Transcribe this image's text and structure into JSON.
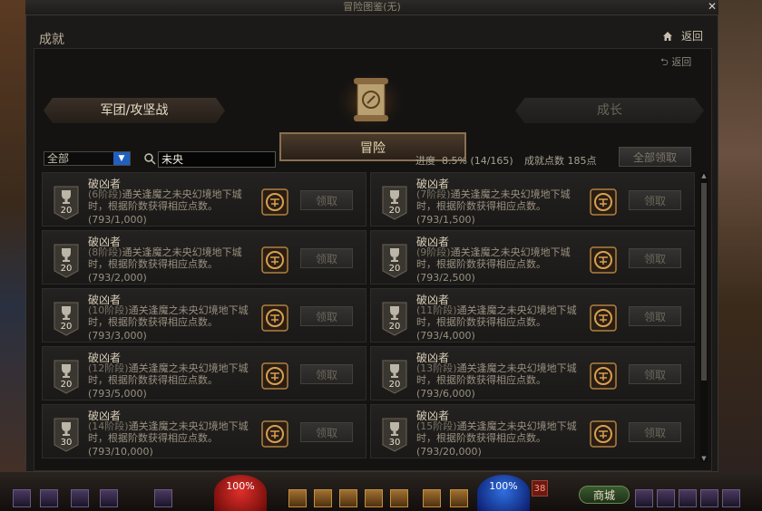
{
  "window": {
    "title": "冒险图鉴(无)",
    "section_title": "成就",
    "back_label": "返回",
    "back_label_2": "返回"
  },
  "tabs": {
    "left": "军团/攻坚战",
    "middle": "冒险",
    "right": "成长"
  },
  "filter": {
    "selected": "全部",
    "search_value": "未央"
  },
  "stats": {
    "progress_label": "进度",
    "progress_value": "8.5% (14/165)",
    "points_label": "成就点数",
    "points_value": "185点",
    "claim_all_label": "全部领取"
  },
  "achievements": [
    {
      "title": "破凶者",
      "stage": "(6阶段)",
      "desc": "通关逢魔之未央幻境地下城时，根据阶数获得相应点数。",
      "progress": "(793/1,000)",
      "badge": "20",
      "claim": "领取"
    },
    {
      "title": "破凶者",
      "stage": "(7阶段)",
      "desc": "通关逢魔之未央幻境地下城时，根据阶数获得相应点数。",
      "progress": "(793/1,500)",
      "badge": "20",
      "claim": "领取"
    },
    {
      "title": "破凶者",
      "stage": "(8阶段)",
      "desc": "通关逢魔之未央幻境地下城时，根据阶数获得相应点数。",
      "progress": "(793/2,000)",
      "badge": "20",
      "claim": "领取"
    },
    {
      "title": "破凶者",
      "stage": "(9阶段)",
      "desc": "通关逢魔之未央幻境地下城时，根据阶数获得相应点数。",
      "progress": "(793/2,500)",
      "badge": "20",
      "claim": "领取"
    },
    {
      "title": "破凶者",
      "stage": "(10阶段)",
      "desc": "通关逢魔之未央幻境地下城时，根据阶数获得相应点数。",
      "progress": "(793/3,000)",
      "badge": "20",
      "claim": "领取"
    },
    {
      "title": "破凶者",
      "stage": "(11阶段)",
      "desc": "通关逢魔之未央幻境地下城时，根据阶数获得相应点数。",
      "progress": "(793/4,000)",
      "badge": "20",
      "claim": "领取"
    },
    {
      "title": "破凶者",
      "stage": "(12阶段)",
      "desc": "通关逢魔之未央幻境地下城时，根据阶数获得相应点数。",
      "progress": "(793/5,000)",
      "badge": "20",
      "claim": "领取"
    },
    {
      "title": "破凶者",
      "stage": "(13阶段)",
      "desc": "通关逢魔之未央幻境地下城时，根据阶数获得相应点数。",
      "progress": "(793/6,000)",
      "badge": "20",
      "claim": "领取"
    },
    {
      "title": "破凶者",
      "stage": "(14阶段)",
      "desc": "通关逢魔之未央幻境地下城时，根据阶数获得相应点数。",
      "progress": "(793/10,000)",
      "badge": "30",
      "claim": "领取"
    },
    {
      "title": "破凶者",
      "stage": "(15阶段)",
      "desc": "通关逢魔之未央幻境地下城时，根据阶数获得相应点数。",
      "progress": "(793/20,000)",
      "badge": "30",
      "claim": "领取"
    }
  ],
  "hud": {
    "hp": "100%",
    "mp": "100%",
    "level": "38",
    "shop_label": "商城"
  }
}
